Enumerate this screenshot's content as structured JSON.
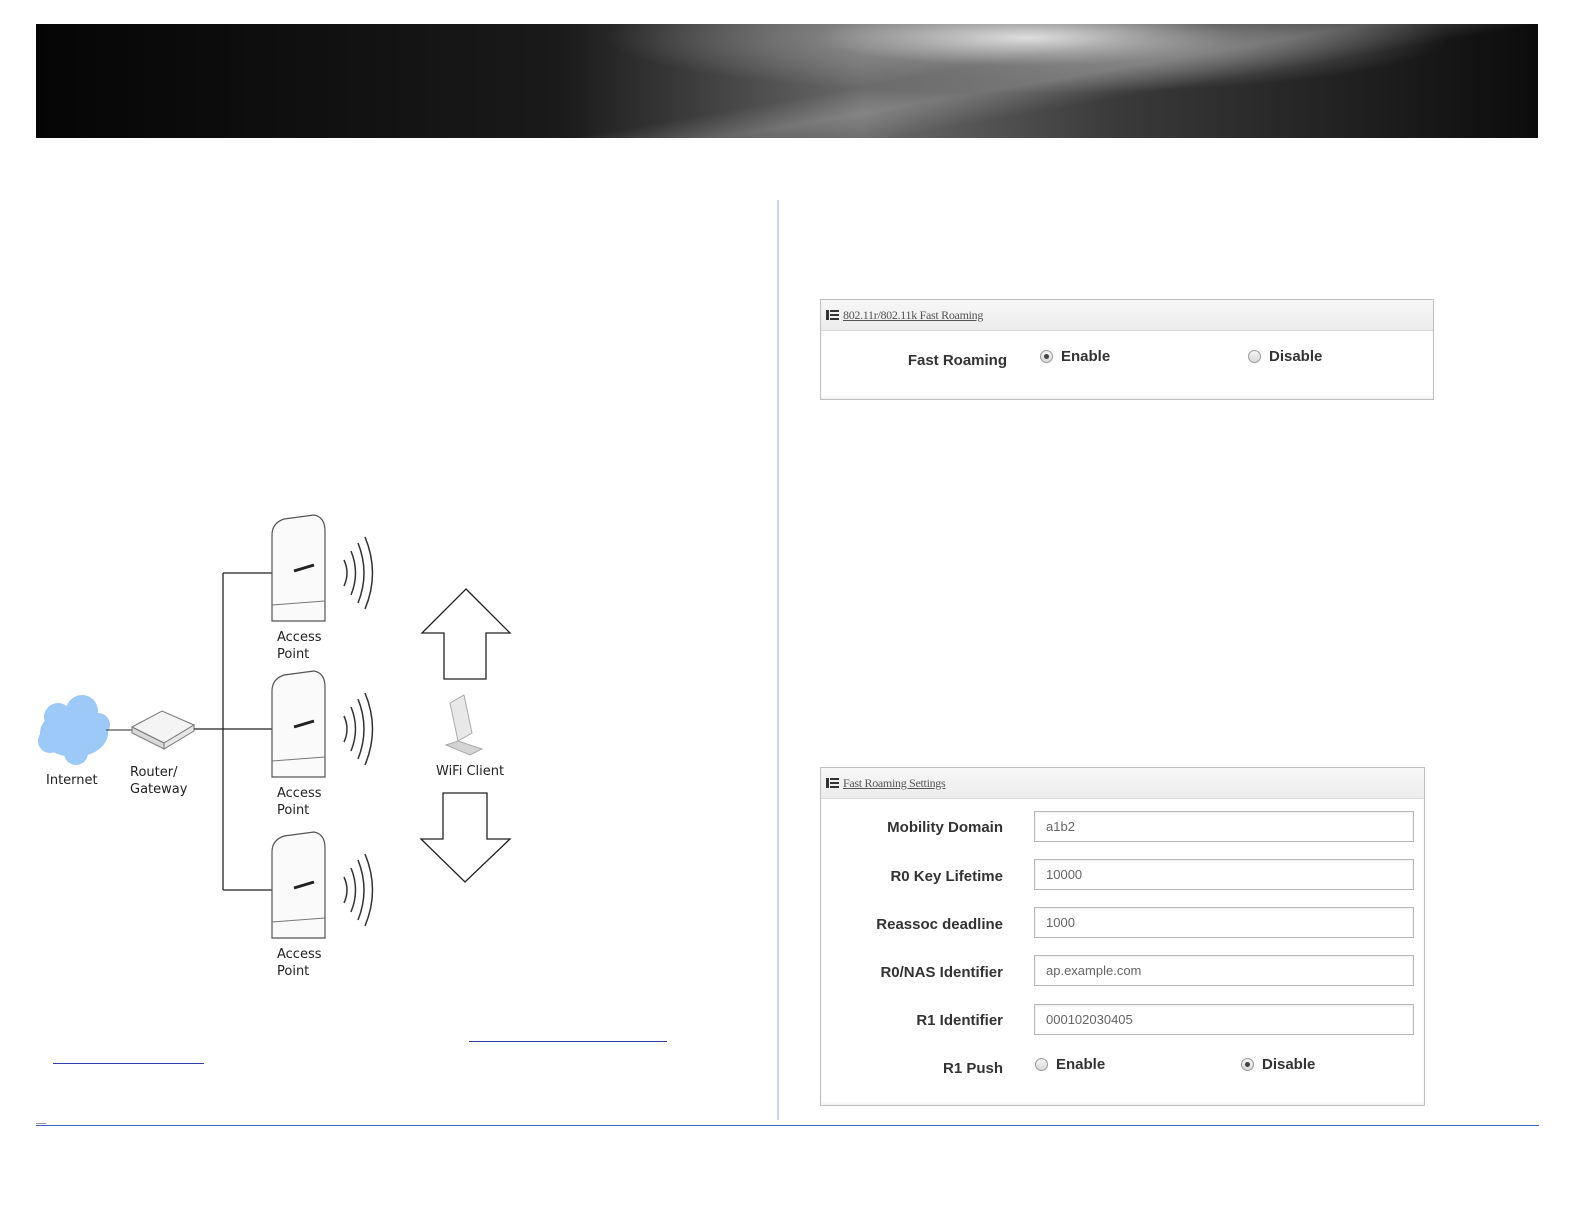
{
  "diagram": {
    "internet_label": "Internet",
    "router_label_1": "Router/",
    "router_label_2": "Gateway",
    "ap_label_1": "Access",
    "ap_label_2": "Point",
    "client_label": "WiFi Client"
  },
  "fast_roaming_panel": {
    "title": "802.11r/802.11k Fast Roaming",
    "label": "Fast Roaming",
    "enable": "Enable",
    "disable": "Disable",
    "selected": "Enable"
  },
  "settings_panel": {
    "title": "Fast Roaming Settings",
    "fields": [
      {
        "label": "Mobility Domain",
        "value": "a1b2"
      },
      {
        "label": "R0 Key Lifetime",
        "value": "10000"
      },
      {
        "label": "Reassoc deadline",
        "value": "1000"
      },
      {
        "label": "R0/NAS Identifier",
        "value": "ap.example.com"
      },
      {
        "label": "R1 Identifier",
        "value": "000102030405"
      }
    ],
    "r1_push": {
      "label": "R1 Push",
      "enable": "Enable",
      "disable": "Disable",
      "selected": "Disable"
    }
  },
  "colors": {
    "accent_line": "#3e64c8",
    "cloud": "#9cc9f7",
    "link": "#2d3fb0"
  }
}
